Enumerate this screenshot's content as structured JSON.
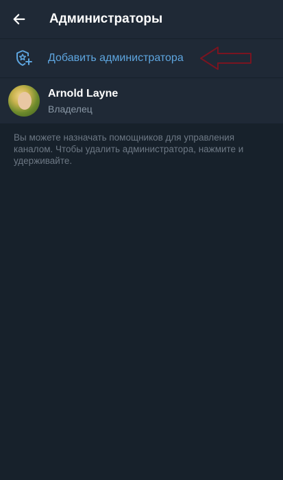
{
  "header": {
    "title": "Администраторы",
    "back_icon": "arrow-left-icon"
  },
  "add_admin": {
    "label": "Добавить администратора",
    "icon": "shield-star-add-icon",
    "annotation_arrow_color": "#7a1420"
  },
  "admins": [
    {
      "name": "Arnold Layne",
      "role": "Владелец",
      "avatar": "user-avatar"
    }
  ],
  "hint": "Вы можете назначать помощников для управления каналом. Чтобы удалить администратора, нажмите и удерживайте.",
  "colors": {
    "background": "#17212b",
    "panel": "#1f2936",
    "accent": "#5ea6e0",
    "secondary_text": "#8a98a6",
    "hint_text": "#6d7884"
  }
}
